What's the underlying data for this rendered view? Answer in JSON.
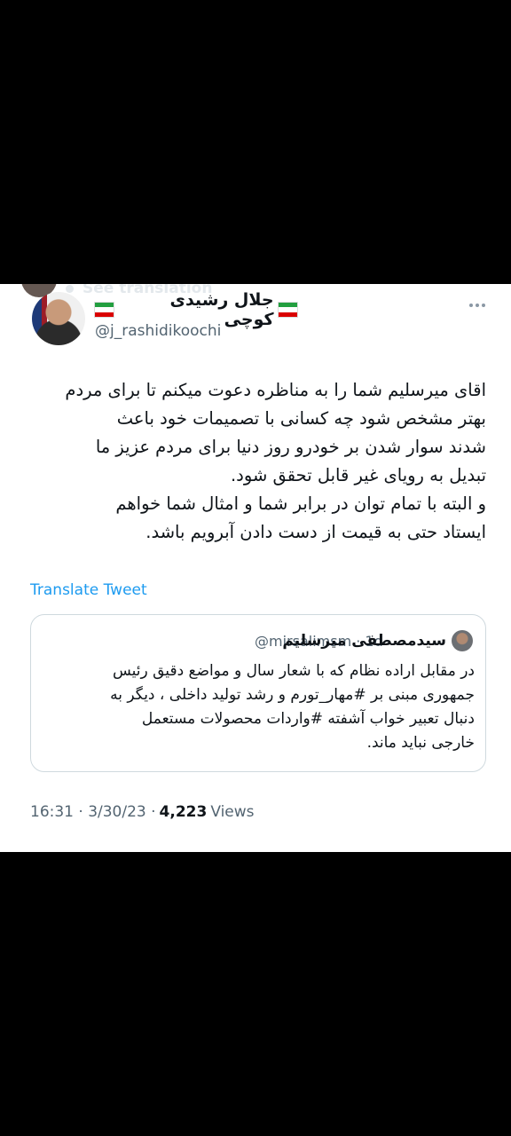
{
  "ghost_header": {
    "label": "See translation"
  },
  "author": {
    "display_name": "جلال رشیدی کوچی",
    "handle": "@j_rashidikoochi"
  },
  "tweet": {
    "lines": [
      "اقای میرسلیم شما را به مناظره دعوت میکنم تا برای مردم",
      "بهتر مشخص شود چه کسانی با تصمیمات خود باعث",
      "شدند سوار شدن بر خودرو روز دنیا برای مردم عزیز ما",
      "تبدیل به رویای غیر قابل تحقق شود.",
      "و البته با تمام توان در برابر شما و امثال شما خواهم",
      "ایستاد حتی به قیمت از دست دادن آبرویم باشد."
    ],
    "translate_label": "Translate Tweet"
  },
  "quoted": {
    "name": "سیدمصطفی میرسلیم",
    "meta": "@mirsalimsm · 1d",
    "lines": [
      "در مقابل اراده نظام که با شعار سال و مواضع دقیق رئیس",
      "جمهوری مبنی بر #مهار_تورم و رشد تولید داخلی ، دیگر به",
      "دنبال تعبیر خواب آشفته #واردات محصولات مستعمل",
      "خارجی نباید ماند."
    ]
  },
  "meta": {
    "time_date": "16:31 · 3/30/23 ·",
    "views_count": "4,223",
    "views_label": "Views"
  }
}
